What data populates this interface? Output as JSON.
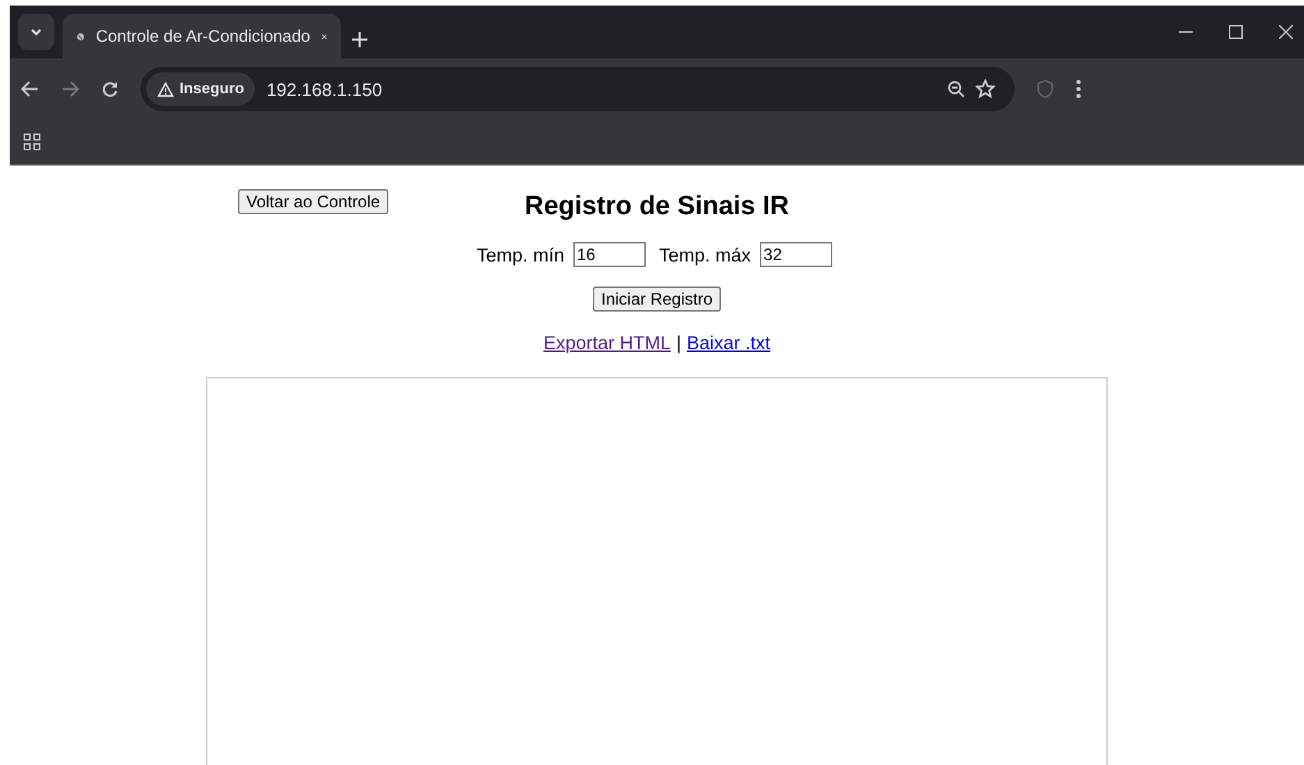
{
  "browser": {
    "tab": {
      "title": "Controle de Ar-Condicionado",
      "selected": true
    },
    "security_badge": "Inseguro",
    "url": "192.168.1.150"
  },
  "page": {
    "back_button": "Voltar ao Controle",
    "title": "Registro de Sinais IR",
    "fields": [
      {
        "label": "Temp. mín",
        "value": "16"
      },
      {
        "label": "Temp. máx",
        "value": "32"
      }
    ],
    "start_button": "Iniciar Registro",
    "links": [
      {
        "label": "Exportar HTML",
        "visited": true
      },
      {
        "label": "Baixar .txt",
        "visited": false
      }
    ],
    "separator": "|"
  }
}
